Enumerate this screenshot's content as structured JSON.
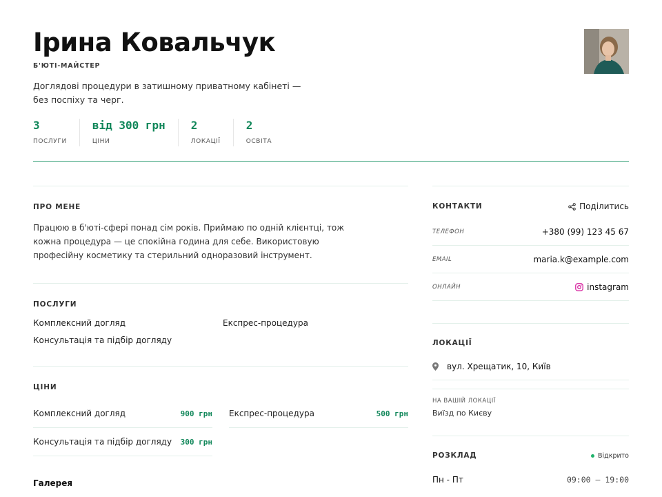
{
  "profile": {
    "name": "Ірина Ковальчук",
    "role": "Б'ЮТІ-МАЙСТЕР",
    "tagline": "Доглядові процедури в затишному приватному кабінеті — без поспіху та черг.",
    "avatar_icon": "portrait-photo"
  },
  "stats": [
    {
      "value": "3",
      "label": "ПОСЛУГИ"
    },
    {
      "value": "від 300 грн",
      "label": "ЦІНИ"
    },
    {
      "value": "2",
      "label": "ЛОКАЦІЇ"
    },
    {
      "value": "2",
      "label": "ОСВІТА"
    }
  ],
  "about": {
    "title": "ПРО МЕНЕ",
    "text": "Працюю в б'юті-сфері понад сім років. Приймаю по одній клієнтці, тож кожна процедура — це спокійна година для себе. Використовую професійну косметику та стерильний одноразовий інструмент."
  },
  "services": {
    "title": "ПОСЛУГИ",
    "items": [
      "Комплексний догляд",
      "Експрес-процедура",
      "Консультація та підбір догляду"
    ]
  },
  "prices": {
    "title": "ЦІНИ",
    "items": [
      {
        "name": "Комплексний догляд",
        "price": "900 грн"
      },
      {
        "name": "Експрес-процедура",
        "price": "500 грн"
      },
      {
        "name": "Консультація та підбір догляду",
        "price": "300 грн"
      }
    ]
  },
  "gallery": {
    "title": "Галерея"
  },
  "contacts": {
    "title": "КОНТАКТИ",
    "share_label": "Поділитись",
    "phone_label": "ТЕЛЕФОН",
    "phone": "+380 (99) 123 45 67",
    "email_label": "EMAIL",
    "email": "maria.k@example.com",
    "online_label": "ОНЛАЙН",
    "online": "instagram"
  },
  "locations": {
    "title": "ЛОКАЦІЇ",
    "address": "вул. Хрещатик, 10, Київ",
    "at_your_label": "НА ВАШІЙ ЛОКАЦІЇ",
    "at_your_value": "Виїзд по Києву"
  },
  "schedule": {
    "title": "РОЗКЛАД",
    "status": "Відкрито",
    "rows": [
      {
        "days": "Пн - Пт",
        "time": "09:00 — 19:00"
      }
    ]
  },
  "colors": {
    "accent": "#11875a",
    "divider": "#2e9d72",
    "open_dot": "#20b26b",
    "instagram": "#d6249f"
  }
}
